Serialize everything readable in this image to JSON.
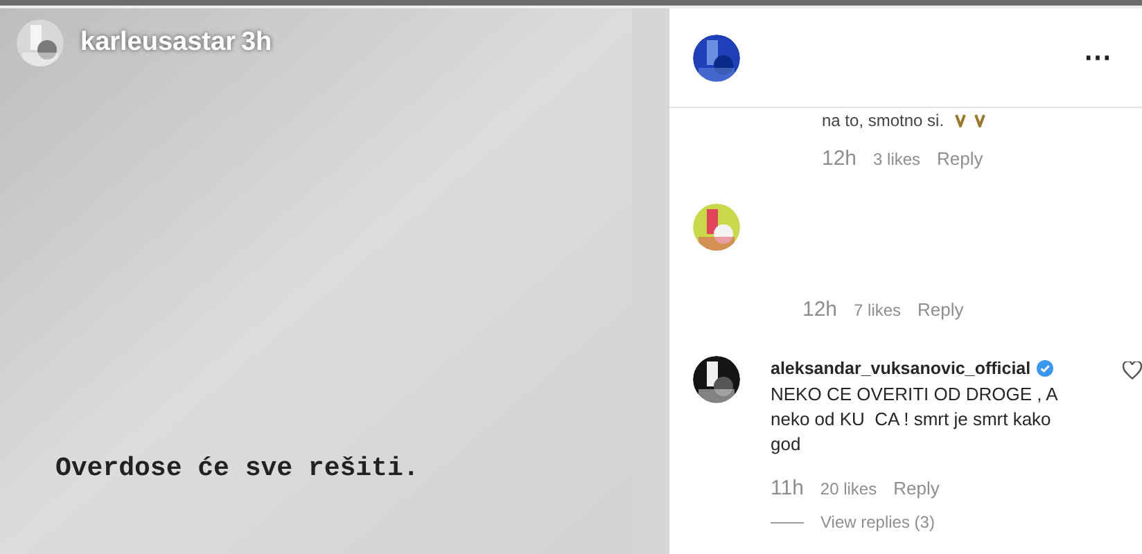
{
  "story": {
    "username": "karleusastar",
    "time": "3h",
    "caption": "Overdose će sve rešiti."
  },
  "comments": [
    {
      "text": "na to, smotno si.",
      "time": "12h",
      "likes": "3 likes",
      "reply": "Reply"
    },
    {
      "time": "12h",
      "likes": "7 likes",
      "reply": "Reply"
    },
    {
      "username": "aleksandar_vuksanovic_official",
      "verified": true,
      "text": "NEKO CE OVERITI OD DROGE , A neko od KU  CA ! smrt je smrt kako god",
      "time": "11h",
      "likes": "20 likes",
      "reply": "Reply",
      "view_replies": "View replies (3)"
    }
  ],
  "more_button": "⋯"
}
